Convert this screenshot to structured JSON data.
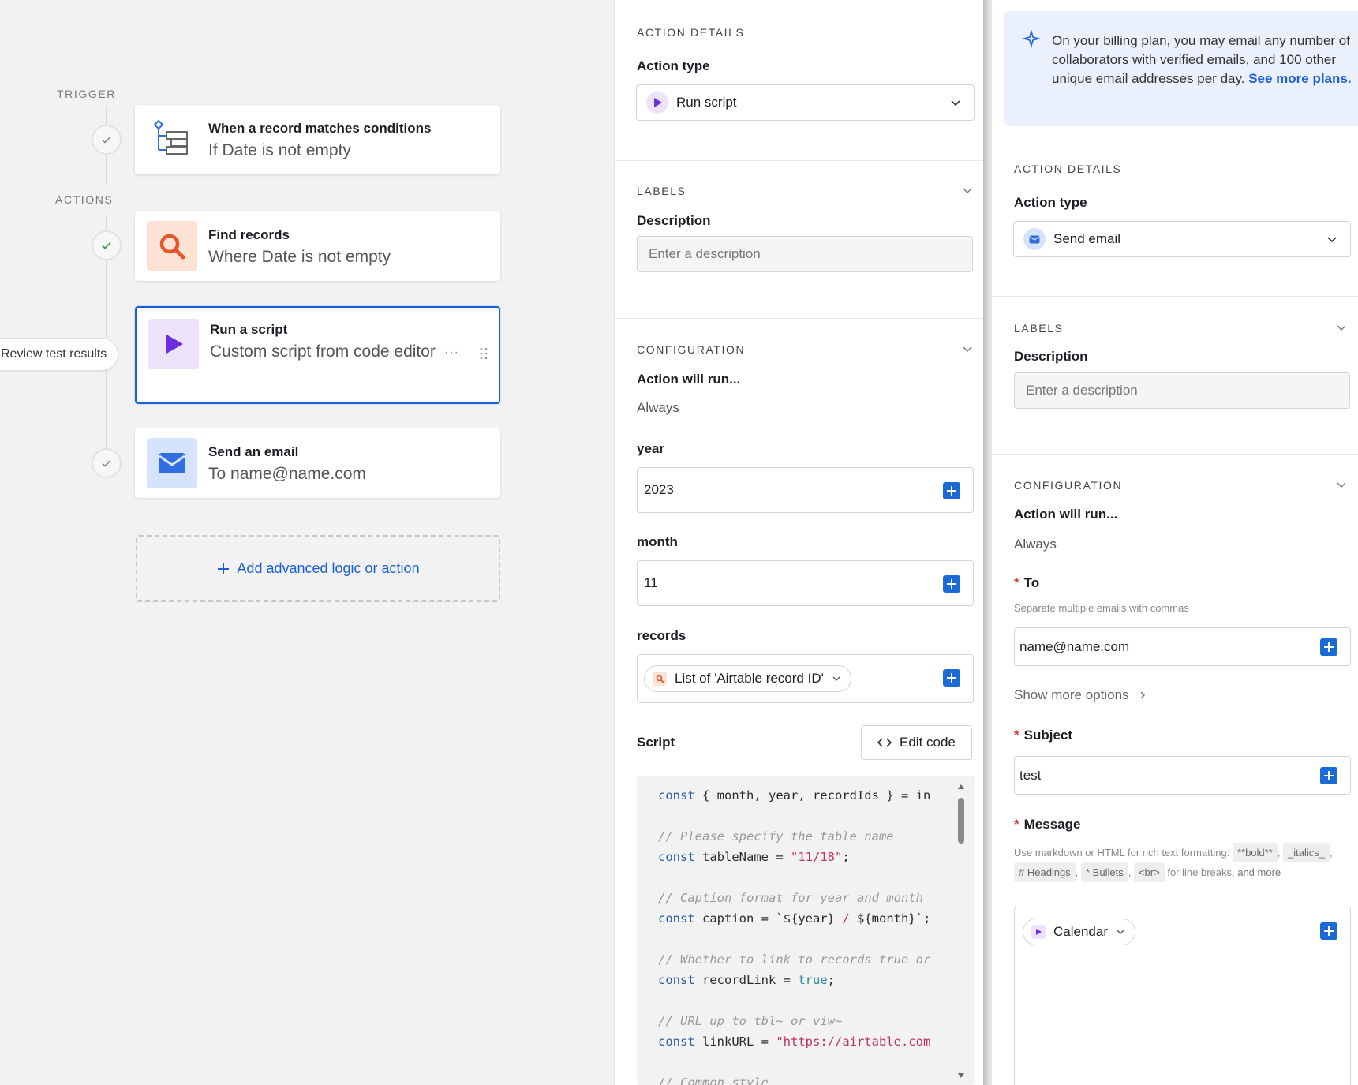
{
  "canvas": {
    "trigger_label": "TRIGGER",
    "actions_label": "ACTIONS",
    "trigger_card": {
      "title": "When a record matches conditions",
      "subtitle": "If Date is not empty"
    },
    "actions": [
      {
        "title": "Find records",
        "subtitle": "Where Date is not empty"
      },
      {
        "title": "Run a script",
        "subtitle": "Custom script from code editor"
      },
      {
        "title": "Send an email",
        "subtitle": "To name@name.com"
      }
    ],
    "review_button": "Review test results",
    "add_logic": "Add advanced logic or action",
    "colors": {
      "accent": "#1a5fd6",
      "find_bg": "#fde2d6",
      "find_fg": "#e5572a",
      "script_bg": "#ece3fb",
      "script_fg": "#6b2fe0",
      "email_bg": "#d6e4fb",
      "email_fg": "#2f6ee0"
    }
  },
  "panel_script": {
    "action_details_label": "ACTION DETAILS",
    "action_type_label": "Action type",
    "action_type_value": "Run script",
    "labels_label": "LABELS",
    "description_label": "Description",
    "description_placeholder": "Enter a description",
    "configuration_label": "CONFIGURATION",
    "action_will_run_label": "Action will run...",
    "action_will_run_value": "Always",
    "inputs": [
      {
        "name": "year",
        "value": "2023"
      },
      {
        "name": "month",
        "value": "11"
      }
    ],
    "records_label": "records",
    "records_value": "List of 'Airtable record ID'",
    "script_label": "Script",
    "edit_code_label": "Edit code",
    "code_lines": [
      "const { month, year, recordIds } = in",
      "",
      "// Please specify the table name",
      "const tableName = \"11/18\";",
      "",
      "// Caption format for year and month",
      "const caption = `${year} / ${month}`;",
      "",
      "// Whether to link to records true or",
      "const recordLink = true;",
      "",
      "// URL up to tbl~ or viw~",
      "const linkURL = \"https://airtable.com",
      "",
      "// Common style"
    ]
  },
  "panel_email": {
    "info_text": "On your billing plan, you may email any number of collaborators with verified emails, and 100 other unique email addresses per day.",
    "info_link": "See more plans.",
    "action_details_label": "ACTION DETAILS",
    "action_type_label": "Action type",
    "action_type_value": "Send email",
    "labels_label": "LABELS",
    "description_label": "Description",
    "description_placeholder": "Enter a description",
    "configuration_label": "CONFIGURATION",
    "action_will_run_label": "Action will run...",
    "action_will_run_value": "Always",
    "to_label": "To",
    "to_hint": "Separate multiple emails with commas",
    "to_value": "name@name.com",
    "show_more": "Show more options",
    "subject_label": "Subject",
    "subject_value": "test",
    "message_label": "Message",
    "message_hint_prefix": "Use markdown or HTML for rich text formatting:",
    "message_hint_chips": [
      "**bold**",
      "_italics_",
      "# Headings",
      "* Bullets",
      "<br>"
    ],
    "message_hint_suffix": "for line breaks,",
    "message_hint_link": "and more",
    "message_token": "Calendar"
  }
}
